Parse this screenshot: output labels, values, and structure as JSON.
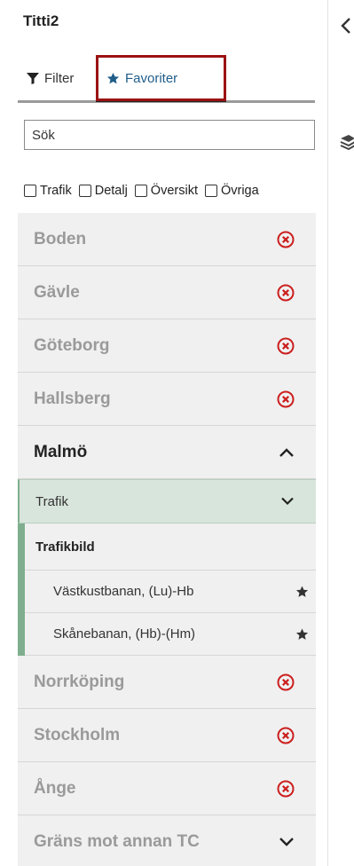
{
  "app": {
    "title": "Titti2"
  },
  "tabs": [
    {
      "label": "Filter",
      "icon": "filter-icon"
    },
    {
      "label": "Favoriter",
      "icon": "star-icon",
      "active": true
    }
  ],
  "search": {
    "placeholder": "Sök",
    "value": ""
  },
  "filters": [
    {
      "label": "Trafik",
      "checked": false
    },
    {
      "label": "Detalj",
      "checked": false
    },
    {
      "label": "Översikt",
      "checked": false
    },
    {
      "label": "Övriga",
      "checked": false
    }
  ],
  "locations": [
    {
      "name": "Boden",
      "icon": "remove-circle-icon"
    },
    {
      "name": "Gävle",
      "icon": "remove-circle-icon"
    },
    {
      "name": "Göteborg",
      "icon": "remove-circle-icon"
    },
    {
      "name": "Hallsberg",
      "icon": "remove-circle-icon"
    },
    {
      "name": "Malmö",
      "icon": "chevron-up-icon",
      "expanded": true
    },
    {
      "name": "Norrköping",
      "icon": "remove-circle-icon"
    },
    {
      "name": "Stockholm",
      "icon": "remove-circle-icon"
    },
    {
      "name": "Ånge",
      "icon": "remove-circle-icon"
    },
    {
      "name": "Gräns mot annan TC",
      "icon": "chevron-down-icon"
    }
  ],
  "malmo": {
    "category": "Trafik",
    "group": "Trafikbild",
    "items": [
      {
        "label": "Västkustbanan, (Lu)-Hb",
        "icon": "star-icon"
      },
      {
        "label": "Skånebanan, (Hb)-(Hm)",
        "icon": "star-icon"
      }
    ]
  },
  "colors": {
    "accent_blue": "#1f5d8a",
    "highlight_red": "#9b1212",
    "remove_red": "#cc1f1f",
    "green_accent": "#7fae8f",
    "green_bg": "#d8e5dc"
  }
}
